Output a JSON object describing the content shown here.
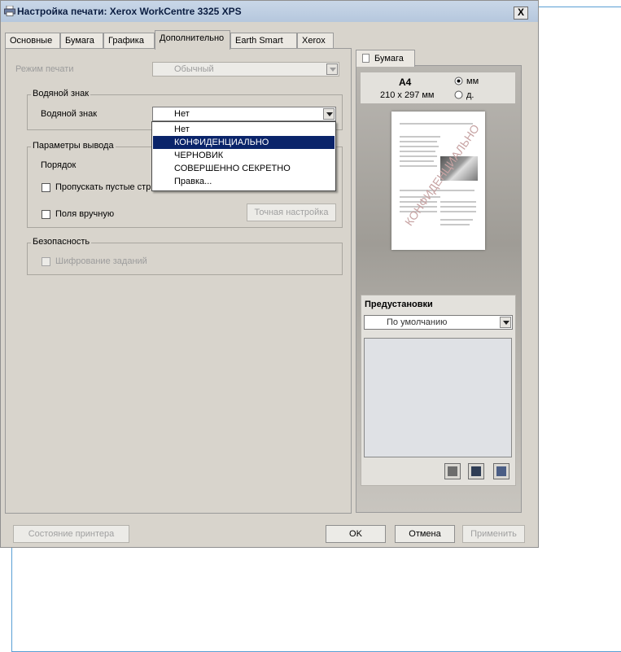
{
  "window": {
    "title": "Настройка печати: Xerox WorkCentre 3325 XPS",
    "close_label": "X"
  },
  "tabs": [
    {
      "label": "Основные"
    },
    {
      "label": "Бумага"
    },
    {
      "label": "Графика"
    },
    {
      "label": "Дополнительно",
      "active": true
    },
    {
      "label": "Earth Smart"
    },
    {
      "label": "Xerox"
    }
  ],
  "print_mode": {
    "label": "Режим печати",
    "value": "Обычный",
    "enabled": false
  },
  "watermark_group": {
    "title": "Водяной знак",
    "field_label": "Водяной знак",
    "value": "Нет",
    "options": [
      "Нет",
      "КОНФИДЕНЦИАЛЬНО",
      "ЧЕРНОВИК",
      "СОВЕРШЕННО СЕКРЕТНО",
      "Правка..."
    ],
    "highlighted_option": "КОНФИДЕНЦИАЛЬНО"
  },
  "output_group": {
    "title": "Параметры вывода",
    "order_label": "Порядок",
    "skip_blank_label": "Пропускать пустые стр",
    "skip_blank_checked": false,
    "manual_margins_label": "Поля вручную",
    "manual_margins_checked": false,
    "fine_tune_label": "Точная настройка"
  },
  "security_group": {
    "title": "Безопасность",
    "encrypt_label": "Шифрование заданий",
    "encrypt_checked": false
  },
  "preview": {
    "tab_label": "Бумага",
    "paper_size": "A4",
    "paper_dims": "210 x 297 мм",
    "unit_mm": "мм",
    "unit_in": "д.",
    "unit_selected": "мм",
    "watermark_text": "КОНФИДЕНЦИАЛЬНО"
  },
  "presets": {
    "title": "Предустановки",
    "value": "По умолчанию"
  },
  "buttons": {
    "printer_status": "Состояние принтера",
    "ok": "OK",
    "cancel": "Отмена",
    "apply": "Применить"
  },
  "icons": [
    "printer-icon",
    "close-icon",
    "paper-icon",
    "preset-new-icon",
    "preset-save-icon",
    "preset-edit-icon"
  ]
}
